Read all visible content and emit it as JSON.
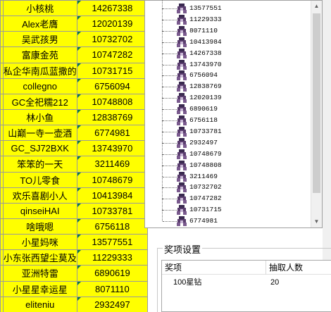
{
  "sheet": {
    "rows": [
      {
        "lead": "",
        "name": "小核桃",
        "id": "14267338"
      },
      {
        "lead": "",
        "name": "Alex老膺",
        "id": "12020139"
      },
      {
        "lead": "",
        "name": "吴武孩男",
        "id": "10732702"
      },
      {
        "lead": "",
        "name": "富康金苑",
        "id": "10747282"
      },
      {
        "lead": "",
        "name": "私企华南瓜蓝撒的",
        "id": "10731715"
      },
      {
        "lead": "",
        "name": "collegno",
        "id": "6756094"
      },
      {
        "lead": "",
        "name": "GC全祀糯212",
        "id": "10748808"
      },
      {
        "lead": "",
        "name": "林小鱼",
        "id": "12838769"
      },
      {
        "lead": "",
        "name": "山巅一寺一壶酒",
        "id": "6774981"
      },
      {
        "lead": "",
        "name": "GC_SJ72BXK",
        "id": "13743970"
      },
      {
        "lead": "",
        "name": "笨笨的一天",
        "id": "3211469"
      },
      {
        "lead": "",
        "name": "TO儿零食",
        "id": "10748679"
      },
      {
        "lead": "",
        "name": "欢乐喜剧小人",
        "id": "10413984"
      },
      {
        "lead": "",
        "name": "qinseiHAI",
        "id": "10733781"
      },
      {
        "lead": "",
        "name": "啥哦嗯",
        "id": "6756118"
      },
      {
        "lead": "",
        "name": "小星妈咪",
        "id": "13577551"
      },
      {
        "lead": "",
        "name": "小东张西望尘莫及",
        "id": "11229333"
      },
      {
        "lead": "",
        "name": "亚洲特雷",
        "id": "6890619"
      },
      {
        "lead": "",
        "name": "小星星幸运星",
        "id": "8071110"
      },
      {
        "lead": "",
        "name": "eliteniu",
        "id": "2932497"
      }
    ]
  },
  "tree": {
    "icon": "user-node-icon",
    "items": [
      "13577551",
      "11229333",
      "8071110",
      "10413984",
      "14267338",
      "13743970",
      "6756094",
      "12838769",
      "12020139",
      "6890619",
      "6756118",
      "10733781",
      "2932497",
      "10748679",
      "10748808",
      "3211469",
      "10732702",
      "10747282",
      "10731715",
      "6774981"
    ]
  },
  "scroll": {
    "up_icon": "scroll-up-icon",
    "down_icon": "scroll-down-icon"
  },
  "prize": {
    "group_title": "奖项设置",
    "col_prize": "奖项",
    "col_count": "抽取人数",
    "rows": [
      {
        "prize": "100星钻",
        "count": "20"
      }
    ]
  },
  "colors": {
    "sheet_bg": "#ffff00",
    "grid": "#9a9a9a",
    "node_icon": "#5a3d6e"
  }
}
